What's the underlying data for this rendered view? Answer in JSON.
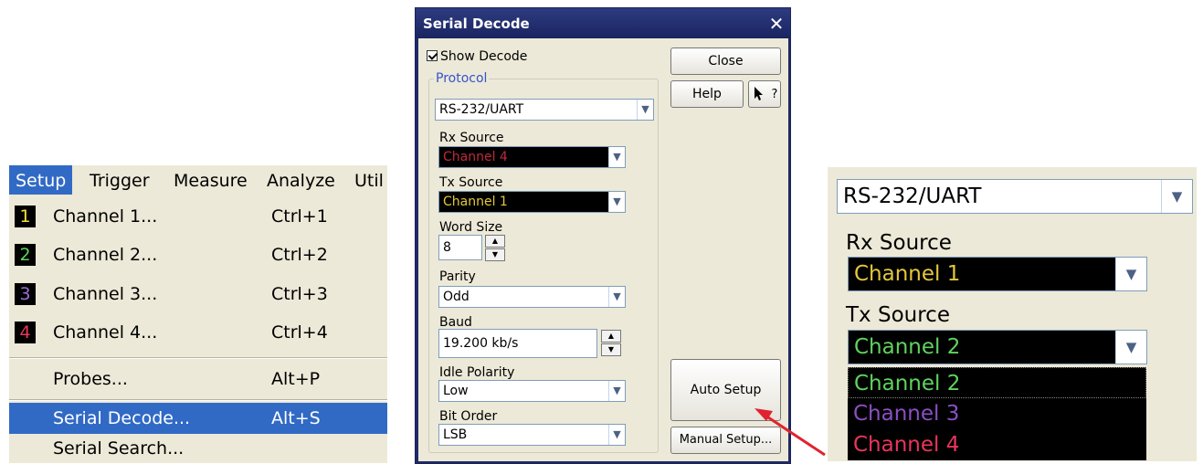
{
  "menu": {
    "bar": [
      "Setup",
      "Trigger",
      "Measure",
      "Analyze",
      "Util"
    ],
    "items": [
      {
        "badge": "1",
        "badge_color": "#f5e03a",
        "label": "Channel 1...",
        "shortcut": "Ctrl+1"
      },
      {
        "badge": "2",
        "badge_color": "#5fd35f",
        "label": "Channel 2...",
        "shortcut": "Ctrl+2"
      },
      {
        "badge": "3",
        "badge_color": "#9b6fd0",
        "label": "Channel 3...",
        "shortcut": "Ctrl+3"
      },
      {
        "badge": "4",
        "badge_color": "#e8365a",
        "label": "Channel 4...",
        "shortcut": "Ctrl+4"
      },
      {
        "label": "Probes...",
        "shortcut": "Alt+P"
      },
      {
        "label": "Serial Decode...",
        "shortcut": "Alt+S",
        "selected": true
      },
      {
        "label": "Serial Search..."
      }
    ]
  },
  "dialog": {
    "title": "Serial Decode",
    "close_glyph": "✕",
    "show_decode": "Show Decode",
    "protocol_group": "Protocol",
    "protocol_value": "RS-232/UART",
    "rx_label": "Rx Source",
    "rx_value": "Channel 4",
    "tx_label": "Tx Source",
    "tx_value": "Channel 1",
    "word_size_label": "Word Size",
    "word_size_value": "8",
    "parity_label": "Parity",
    "parity_value": "Odd",
    "baud_label": "Baud",
    "baud_value": "19.200 kb/s",
    "idle_label": "Idle Polarity",
    "idle_value": "Low",
    "bit_order_label": "Bit Order",
    "bit_order_value": "LSB",
    "close_button": "Close",
    "help_button": "Help",
    "whats_this_glyph": "?",
    "auto_setup_button": "Auto Setup",
    "manual_setup_button": "Manual Setup..."
  },
  "zoom": {
    "protocol_value": "RS-232/UART",
    "rx_label": "Rx Source",
    "rx_value": "Channel 1",
    "tx_label": "Tx Source",
    "tx_value": "Channel 2",
    "options": [
      {
        "label": "Channel 2",
        "color": "#5fd35f"
      },
      {
        "label": "Channel 3",
        "color": "#8a4fc4"
      },
      {
        "label": "Channel 4",
        "color": "#e8365a"
      }
    ]
  },
  "colors": {
    "channel1": "#e3c83a",
    "channel2": "#5fd35f",
    "channel4": "#c0283e",
    "selection": "#316ac5",
    "arrow": "#e0232e"
  }
}
